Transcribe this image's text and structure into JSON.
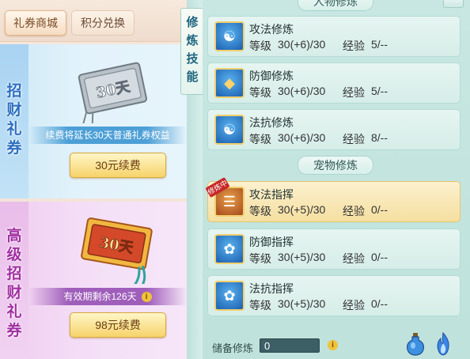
{
  "tabs": {
    "mall": "礼券商城",
    "points": "积分兑换"
  },
  "card1": {
    "vertical_title": [
      "招",
      "财",
      "礼",
      "券"
    ],
    "ticket_text": "30天",
    "description": "续费将延长30天普通礼券权益",
    "button": "30元续费"
  },
  "card2": {
    "vertical_title": [
      "高",
      "级",
      "招",
      "财",
      "礼",
      "券"
    ],
    "ticket_text": "30天",
    "description": "有效期剩余126天",
    "button": "98元续费"
  },
  "side_tab": [
    "修",
    "炼",
    "技",
    "能"
  ],
  "sections": {
    "player": "人物修炼",
    "pet": "宠物修炼"
  },
  "labels": {
    "level": "等级",
    "exp": "经验",
    "training_badge": "修炼中"
  },
  "player_skills": [
    {
      "name": "攻法修炼",
      "level": "30(+6)/30",
      "exp": "5/--",
      "icon": "meditating-figure-icon"
    },
    {
      "name": "防御修炼",
      "level": "30(+6)/30",
      "exp": "5/--",
      "icon": "shield-icon"
    },
    {
      "name": "法抗修炼",
      "level": "30(+6)/30",
      "exp": "8/--",
      "icon": "yin-yang-shield-icon"
    }
  ],
  "pet_skills": [
    {
      "name": "攻法指挥",
      "level": "30(+5)/30",
      "exp": "0/--",
      "icon": "scroll-icon",
      "active": true
    },
    {
      "name": "防御指挥",
      "level": "30(+5)/30",
      "exp": "0/--",
      "icon": "paw-icon"
    },
    {
      "name": "法抗指挥",
      "level": "30(+5)/30",
      "exp": "0/--",
      "icon": "paw-shield-icon"
    }
  ],
  "reserve": {
    "label": "储备修炼",
    "value": "0"
  },
  "colors": {
    "accent_gold": "#f6d36a",
    "panel_teal": "#c8e7e2",
    "card1_blue": "#cde9f7",
    "card2_pink": "#f1ccef"
  }
}
